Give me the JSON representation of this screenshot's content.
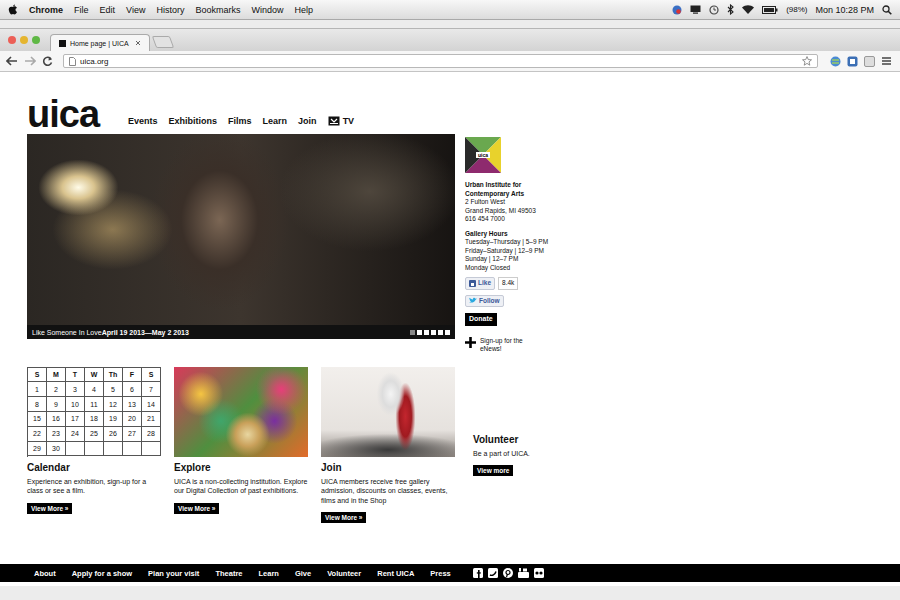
{
  "menubar": {
    "app": "Chrome",
    "menus": [
      "File",
      "Edit",
      "View",
      "History",
      "Bookmarks",
      "Window",
      "Help"
    ],
    "battery": "(98%)",
    "clock": "Mon 10:28 PM"
  },
  "browser": {
    "tabs": [
      {
        "label": "Home page | UICA",
        "selected": true
      }
    ],
    "url": "uica.org"
  },
  "site": {
    "logo": "uica",
    "nav": [
      {
        "label": "Events",
        "kind": "text"
      },
      {
        "label": "Exhibitions",
        "kind": "text"
      },
      {
        "label": "Films",
        "kind": "text"
      },
      {
        "label": "Learn",
        "kind": "text"
      },
      {
        "label": "Join",
        "kind": "text"
      },
      {
        "label": "TV",
        "kind": "tv"
      }
    ],
    "hero": {
      "title": "Like Someone In Love",
      "dates": "April 19 2013—May 2 2013",
      "slides": [
        {
          "selected": true
        },
        {
          "selected": false
        },
        {
          "selected": false
        },
        {
          "selected": false
        },
        {
          "selected": false
        },
        {
          "selected": false
        }
      ]
    },
    "info": {
      "badge": "uica",
      "name": "Urban Institute for Contemporary Arts",
      "address": [
        "2 Fulton West",
        "Grand Rapids, MI 49503",
        "616 454 7000"
      ],
      "hours_title": "Gallery Hours",
      "hours": [
        "Tuesday–Thursday | 5–9 PM",
        "Friday–Saturday | 12–9 PM",
        "Sunday | 12–7 PM",
        "Monday Closed"
      ],
      "like": "Like",
      "like_count": "8.4k",
      "follow": "Follow",
      "donate": "Donate",
      "enews": "Sign-up for the eNews!"
    },
    "calendar": {
      "days": [
        "S",
        "M",
        "T",
        "W",
        "Th",
        "F",
        "S"
      ],
      "weeks": [
        [
          "1",
          "2",
          "3",
          "4",
          "5",
          "6",
          "7"
        ],
        [
          "8",
          "9",
          "10",
          "11",
          "12",
          "13",
          "14"
        ],
        [
          "15",
          "16",
          "17",
          "18",
          "19",
          "20",
          "21"
        ],
        [
          "22",
          "23",
          "24",
          "25",
          "26",
          "27",
          "28"
        ],
        [
          "29",
          "30",
          "",
          "",
          "",
          "",
          ""
        ]
      ]
    },
    "cards": [
      {
        "kind": "calendar",
        "title": "Calendar",
        "text": "Experience an exhibition, sign-up for a class or see a film.",
        "button": "View More »"
      },
      {
        "kind": "explore",
        "title": "Explore",
        "text": "UICA is a non-collecting institution. Explore our Digital Collection of past exhibitions.",
        "button": "View More »"
      },
      {
        "kind": "join",
        "title": "Join",
        "text": "UICA members receive free gallery admission, discounts on classes, events, films and in the Shop",
        "button": "View More »"
      }
    ],
    "volunteer": {
      "title": "Volunteer",
      "text": "Be a part of UICA.",
      "button": "View more"
    },
    "footer": [
      "About",
      "Apply for a show",
      "Plan your visit",
      "Theatre",
      "Learn",
      "Give",
      "Volunteer",
      "Rent UICA",
      "Press"
    ]
  }
}
